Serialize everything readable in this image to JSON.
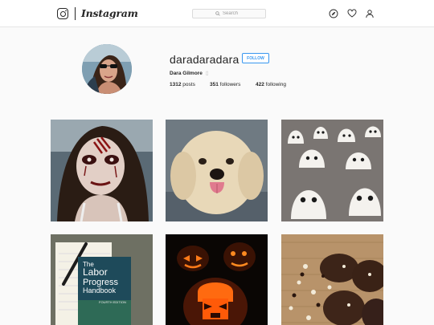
{
  "nav": {
    "logo_text": "Instagram",
    "search_placeholder": "Search",
    "icons": [
      "instagram-glyph-icon",
      "search-icon",
      "explore-compass-icon",
      "heart-icon",
      "profile-person-icon"
    ]
  },
  "profile": {
    "username": "daradaradara",
    "follow_label": "FOLLOW",
    "full_name": "Dara Gilmore",
    "stats": {
      "posts_count": "1312",
      "posts_label": "posts",
      "followers_count": "351",
      "followers_label": "followers",
      "following_count": "422",
      "following_label": "following"
    }
  },
  "posts": [
    {
      "name": "zombie-makeup-photo"
    },
    {
      "name": "fluffy-dog-photo"
    },
    {
      "name": "meringue-ghosts-photo"
    },
    {
      "name": "labor-progress-book-photo",
      "book_title_lines": [
        "The",
        "Labor",
        "Progress",
        "Handbook"
      ],
      "book_edition": "FOURTH EDITION"
    },
    {
      "name": "carved-pumpkins-photo"
    },
    {
      "name": "chocolate-cookies-photo"
    }
  ],
  "colors": {
    "accent_blue": "#3897f0",
    "border": "#dbdbdb",
    "background": "#fafafa",
    "text": "#262626"
  }
}
